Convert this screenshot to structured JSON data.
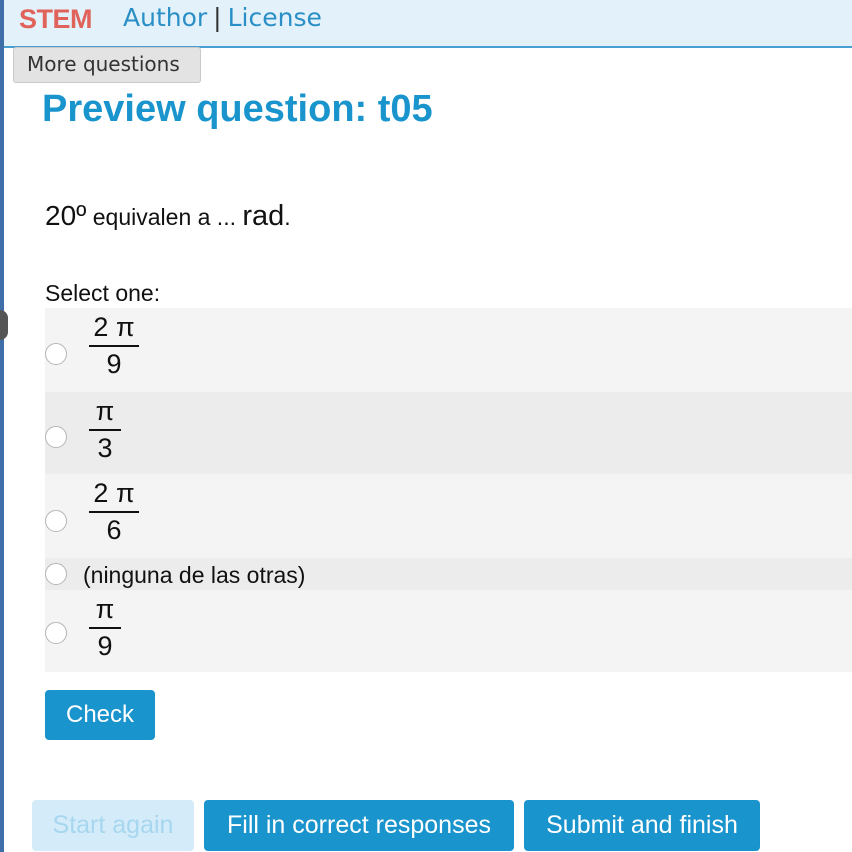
{
  "header": {
    "brand": "STEM",
    "nav_author": "Author",
    "nav_separator": "|",
    "nav_license": "License",
    "more_questions": "More questions"
  },
  "page": {
    "title": "Preview question: t05"
  },
  "question": {
    "angle": "20º",
    "text": " equivalen a ... ",
    "unit": "rad",
    "end": ".",
    "select_prompt": "Select one:",
    "options": [
      {
        "numerator": "2 π",
        "denominator": "9"
      },
      {
        "numerator": "π",
        "denominator": "3"
      },
      {
        "numerator": "2 π",
        "denominator": "6"
      },
      {
        "text": "(ninguna de las otras)"
      },
      {
        "numerator": "π",
        "denominator": "9"
      }
    ]
  },
  "actions": {
    "check": "Check",
    "start_again": "Start again",
    "fill_correct": "Fill in correct responses",
    "submit_finish": "Submit and finish"
  },
  "colors": {
    "brand": "#e0635b",
    "accent": "#1a94cc",
    "topbar_bg": "#e3f1fb"
  }
}
